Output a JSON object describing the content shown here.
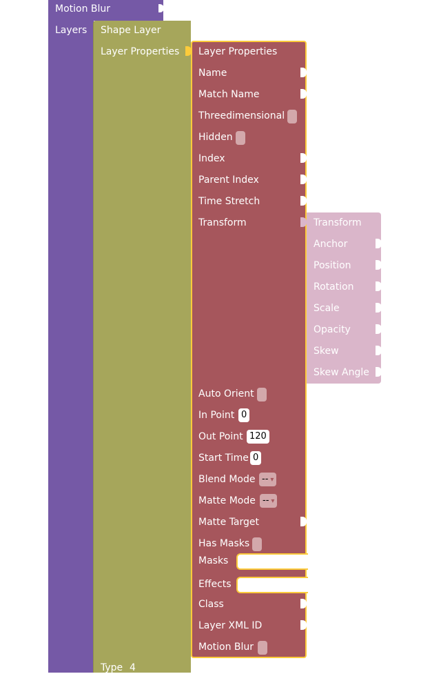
{
  "colors": {
    "purple": "#7559a6",
    "olive": "#a6a65b",
    "red": "#a6565c",
    "pink": "#dab6ca",
    "highlight": "#fccb3b",
    "field_bg": "#ffffff",
    "field_on_red": "#d3a8ab",
    "field_on_pink": "#ecd5e1"
  },
  "purple_block": {
    "motion_blur_label": "Motion Blur",
    "layers_label": "Layers"
  },
  "shape_layer": {
    "title": "Shape Layer",
    "layer_properties_label": "Layer Properties",
    "type_label": "Type",
    "type_value": "4"
  },
  "layer_properties": {
    "title": "Layer Properties",
    "name": "Name",
    "match_name": "Match Name",
    "threedimensional": "Threedimensional",
    "hidden": "Hidden",
    "index": "Index",
    "parent_index": "Parent Index",
    "time_stretch": "Time Stretch",
    "transform": "Transform",
    "auto_orient": "Auto Orient",
    "in_point": "In Point",
    "in_point_value": "0",
    "out_point": "Out Point",
    "out_point_value": "120",
    "start_time": "Start Time",
    "start_time_value": "0",
    "blend_mode": "Blend Mode",
    "blend_mode_value": "--",
    "matte_mode": "Matte Mode",
    "matte_mode_value": "--",
    "matte_target": "Matte Target",
    "has_masks": "Has Masks",
    "masks": "Masks",
    "effects": "Effects",
    "class": "Class",
    "layer_xml_id": "Layer XML ID",
    "motion_blur": "Motion Blur"
  },
  "transform_block": {
    "title": "Transform",
    "anchor": "Anchor",
    "position": "Position",
    "rotation": "Rotation",
    "scale": "Scale",
    "opacity": "Opacity",
    "skew": "Skew",
    "skew_angle": "Skew Angle"
  },
  "dropdown_arrow": "▾"
}
